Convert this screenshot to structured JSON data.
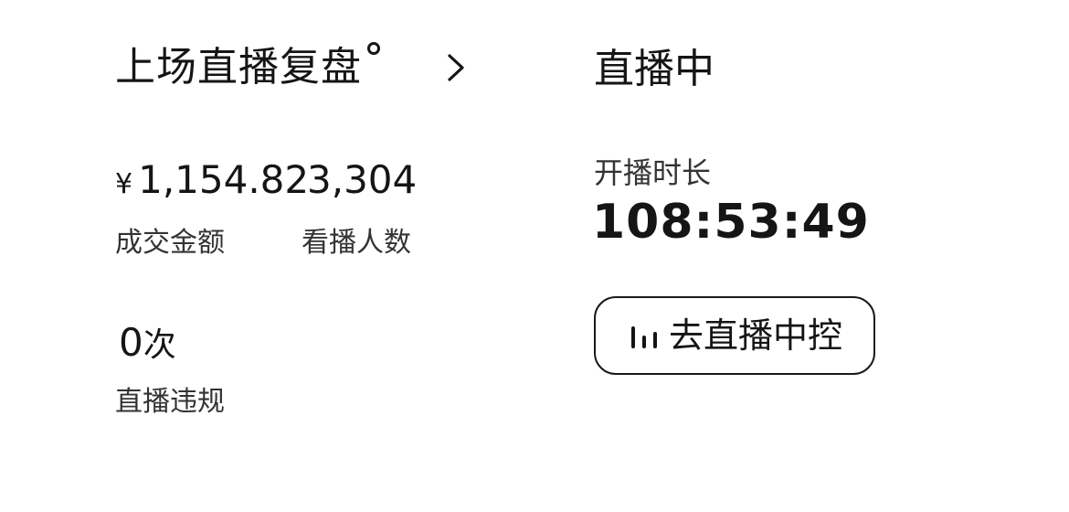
{
  "review": {
    "title": "上场直播复盘",
    "icon": "chevron-right-icon"
  },
  "metrics": [
    {
      "currency": "¥",
      "value": "1,154.82",
      "label": "成交金额"
    },
    {
      "value": "3,304",
      "label": "看播人数"
    },
    {
      "value": "0",
      "unit": "次",
      "label": "直播违规"
    }
  ],
  "live": {
    "status": "直播中",
    "duration_label": "开播时长",
    "duration_value": "108:53:49",
    "console_button_label": "去直播中控",
    "console_button_icon": "bar-chart-icon"
  }
}
